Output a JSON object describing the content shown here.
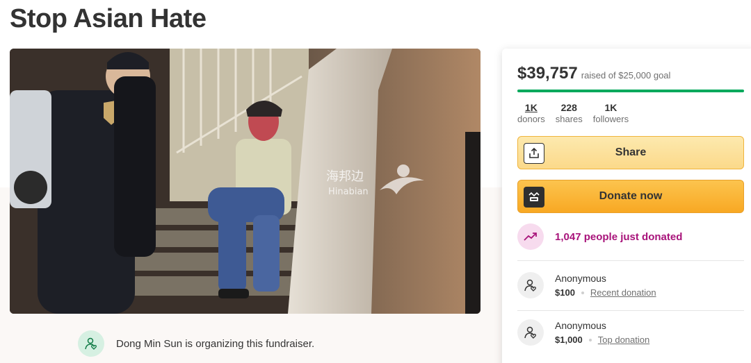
{
  "campaign": {
    "title": "Stop Asian Hate",
    "photo_watermark": {
      "cn": "海邦边",
      "latin": "Hinabian"
    },
    "organizer_text": "Dong Min Sun is organizing this fundraiser."
  },
  "sidebar": {
    "raised_amount": "$39,757",
    "raised_goal_text": "raised of $25,000 goal",
    "progress_fraction": 1.0,
    "stats": [
      {
        "value": "1K",
        "label": "donors"
      },
      {
        "value": "228",
        "label": "shares"
      },
      {
        "value": "1K",
        "label": "followers"
      }
    ],
    "share_label": "Share",
    "donate_label": "Donate now",
    "trending_text": "1,047 people just donated",
    "donations": [
      {
        "name": "Anonymous",
        "amount": "$100",
        "tag": "Recent donation"
      },
      {
        "name": "Anonymous",
        "amount": "$1,000",
        "tag": "Top donation"
      }
    ]
  },
  "colors": {
    "progress": "#02a95c",
    "trending_text": "#a8137a",
    "donate_button": "#f8a823",
    "share_button": "#fbd98a"
  },
  "icons": [
    "share-icon",
    "gofundme-logo-icon",
    "trending-up-icon",
    "donor-heart-icon",
    "organizer-heart-icon"
  ]
}
